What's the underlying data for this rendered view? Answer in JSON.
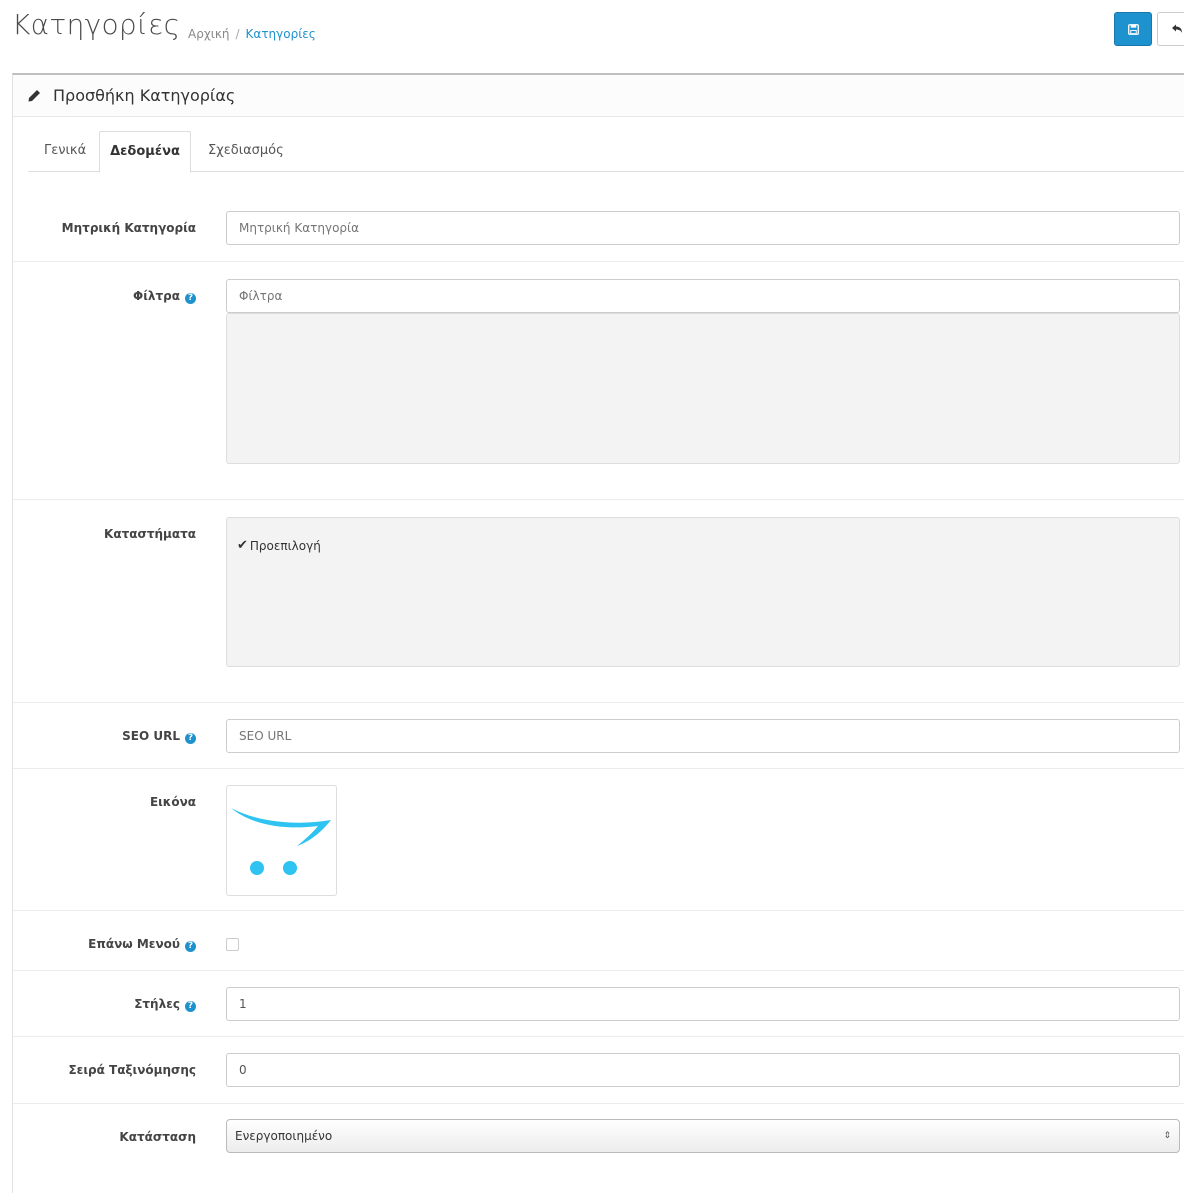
{
  "header": {
    "title": "Κατηγορίες",
    "breadcrumb": [
      "Αρχική",
      "Κατηγορίες"
    ],
    "save_icon": "floppy-disk-icon",
    "back_icon": "reply-arrow-icon",
    "accent_color": "#1e91cf"
  },
  "panel": {
    "heading": "Προσθήκη Κατηγορίας",
    "heading_icon": "pencil-icon"
  },
  "tabs": [
    {
      "label": "Γενικά",
      "active": false
    },
    {
      "label": "Δεδομένα",
      "active": true
    },
    {
      "label": "Σχεδιασμός",
      "active": false
    }
  ],
  "form": {
    "parent": {
      "label": "Μητρική Κατηγορία",
      "placeholder": "Μητρική Κατηγορία",
      "value": ""
    },
    "filters": {
      "label": "Φίλτρα",
      "placeholder": "Φίλτρα",
      "value": ""
    },
    "stores": {
      "label": "Καταστήματα",
      "options": [
        {
          "label": "Προεπιλογή",
          "checked": true
        }
      ]
    },
    "seo_url": {
      "label": "SEO URL",
      "placeholder": "SEO URL",
      "value": ""
    },
    "image": {
      "label": "Εικόνα",
      "icon": "opencart-cart-logo"
    },
    "top_menu": {
      "label": "Επάνω Μενού",
      "checked": false
    },
    "columns": {
      "label": "Στήλες",
      "value": "1"
    },
    "sort_order": {
      "label": "Σειρά Ταξινόμησης",
      "value": "0"
    },
    "status": {
      "label": "Κατάσταση",
      "selected": "Ενεργοποιημένο"
    }
  }
}
